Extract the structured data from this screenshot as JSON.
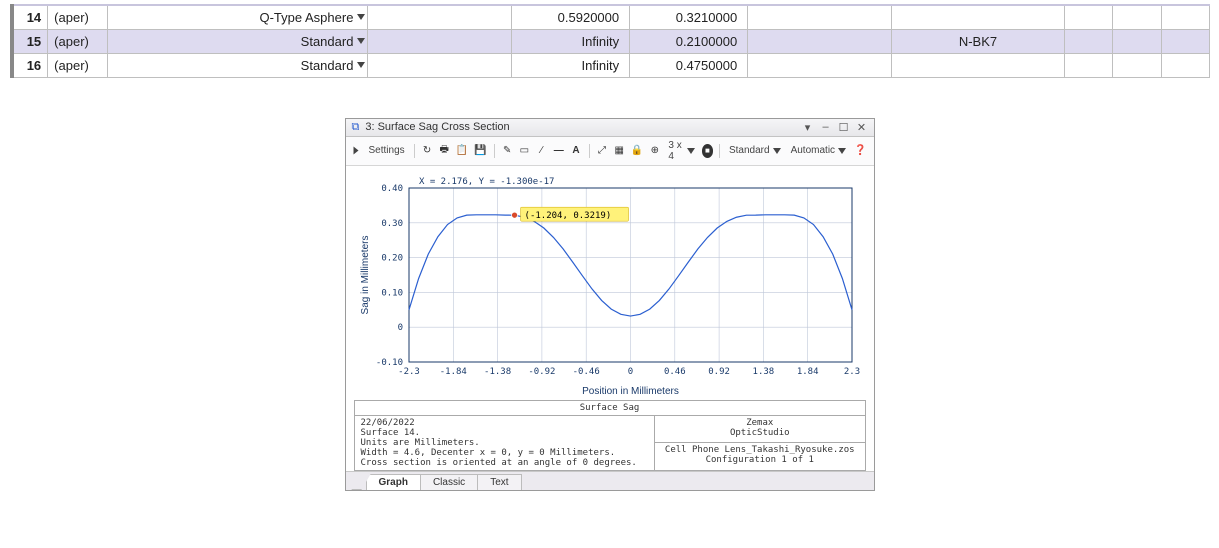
{
  "sheet": {
    "rows": [
      {
        "num": "14",
        "comment": "(aper)",
        "type": "Q-Type Asphere",
        "radius": "0.5920000",
        "thick": "0.3210000",
        "material": "",
        "sel": false
      },
      {
        "num": "15",
        "comment": "(aper)",
        "type": "Standard",
        "radius": "Infinity",
        "thick": "0.2100000",
        "material": "N-BK7",
        "sel": true
      },
      {
        "num": "16",
        "comment": "(aper)",
        "type": "Standard",
        "radius": "Infinity",
        "thick": "0.4750000",
        "material": "",
        "sel": false
      }
    ]
  },
  "window": {
    "index": "3",
    "title_prefix": "3: ",
    "title": "Surface Sag Cross Section",
    "settings_label": "Settings",
    "zoom_label": "3 x 4",
    "mode1": "Standard",
    "mode2": "Automatic",
    "coord_readout": "X = 2.176, Y = -1.300e-17",
    "cursor_point": "(-1.204, 0.3219)",
    "tabs": {
      "graph": "Graph",
      "classic": "Classic",
      "text": "Text"
    },
    "ctrls": {
      "pin": "▾",
      "min": "–",
      "max": "☐",
      "close": "✕"
    }
  },
  "footer": {
    "caption": "Surface Sag",
    "vendor1": "Zemax",
    "vendor2": "OpticStudio",
    "date": "22/06/2022",
    "line1": "Surface 14.",
    "line2": "Units are Millimeters.",
    "line3": "Width = 4.6, Decenter x = 0, y = 0 Millimeters.",
    "line4": "Cross section is oriented at an angle of 0 degrees.",
    "file": "Cell Phone Lens_Takashi_Ryosuke.zos",
    "config": "Configuration 1 of 1"
  },
  "chart_data": {
    "type": "line",
    "title": "Surface Sag",
    "xlabel": "Position in Millimeters",
    "ylabel": "Sag in Millimeters",
    "xlim": [
      -2.3,
      2.3
    ],
    "ylim": [
      -0.1,
      0.4
    ],
    "xticks": [
      -2.3,
      -1.84,
      -1.38,
      -0.92,
      -0.46,
      0,
      0.46,
      0.92,
      1.38,
      1.84,
      2.3
    ],
    "yticks": [
      -0.1,
      0,
      0.1,
      0.2,
      0.3,
      0.4
    ],
    "xtick_labels": [
      "-2.3",
      "-1.84",
      "-1.38",
      "-0.92",
      "-0.46",
      "0",
      "0.46",
      "0.92",
      "1.38",
      "1.84",
      "2.3"
    ],
    "ytick_labels": [
      "-0.10",
      "0",
      "0.10",
      "0.20",
      "0.30",
      "0.40"
    ],
    "cursor": {
      "x": -1.204,
      "y": 0.3219,
      "label": "(-1.204, 0.3219)"
    },
    "series": [
      {
        "name": "Sag",
        "x": [
          -2.3,
          -2.2,
          -2.1,
          -2.0,
          -1.9,
          -1.8,
          -1.7,
          -1.6,
          -1.5,
          -1.4,
          -1.3,
          -1.204,
          -1.1,
          -1.0,
          -0.9,
          -0.8,
          -0.7,
          -0.6,
          -0.5,
          -0.4,
          -0.3,
          -0.2,
          -0.1,
          0.0,
          0.1,
          0.2,
          0.3,
          0.4,
          0.5,
          0.6,
          0.7,
          0.8,
          0.9,
          1.0,
          1.1,
          1.204,
          1.3,
          1.4,
          1.5,
          1.6,
          1.7,
          1.8,
          1.9,
          2.0,
          2.1,
          2.2,
          2.3
        ],
        "y": [
          0.05,
          0.14,
          0.21,
          0.26,
          0.295,
          0.314,
          0.322,
          0.323,
          0.323,
          0.323,
          0.322,
          0.3219,
          0.316,
          0.304,
          0.285,
          0.258,
          0.225,
          0.187,
          0.148,
          0.11,
          0.077,
          0.052,
          0.037,
          0.032,
          0.037,
          0.052,
          0.077,
          0.11,
          0.148,
          0.187,
          0.225,
          0.258,
          0.285,
          0.304,
          0.316,
          0.3219,
          0.322,
          0.323,
          0.323,
          0.323,
          0.322,
          0.314,
          0.295,
          0.26,
          0.21,
          0.14,
          0.05
        ]
      }
    ]
  }
}
